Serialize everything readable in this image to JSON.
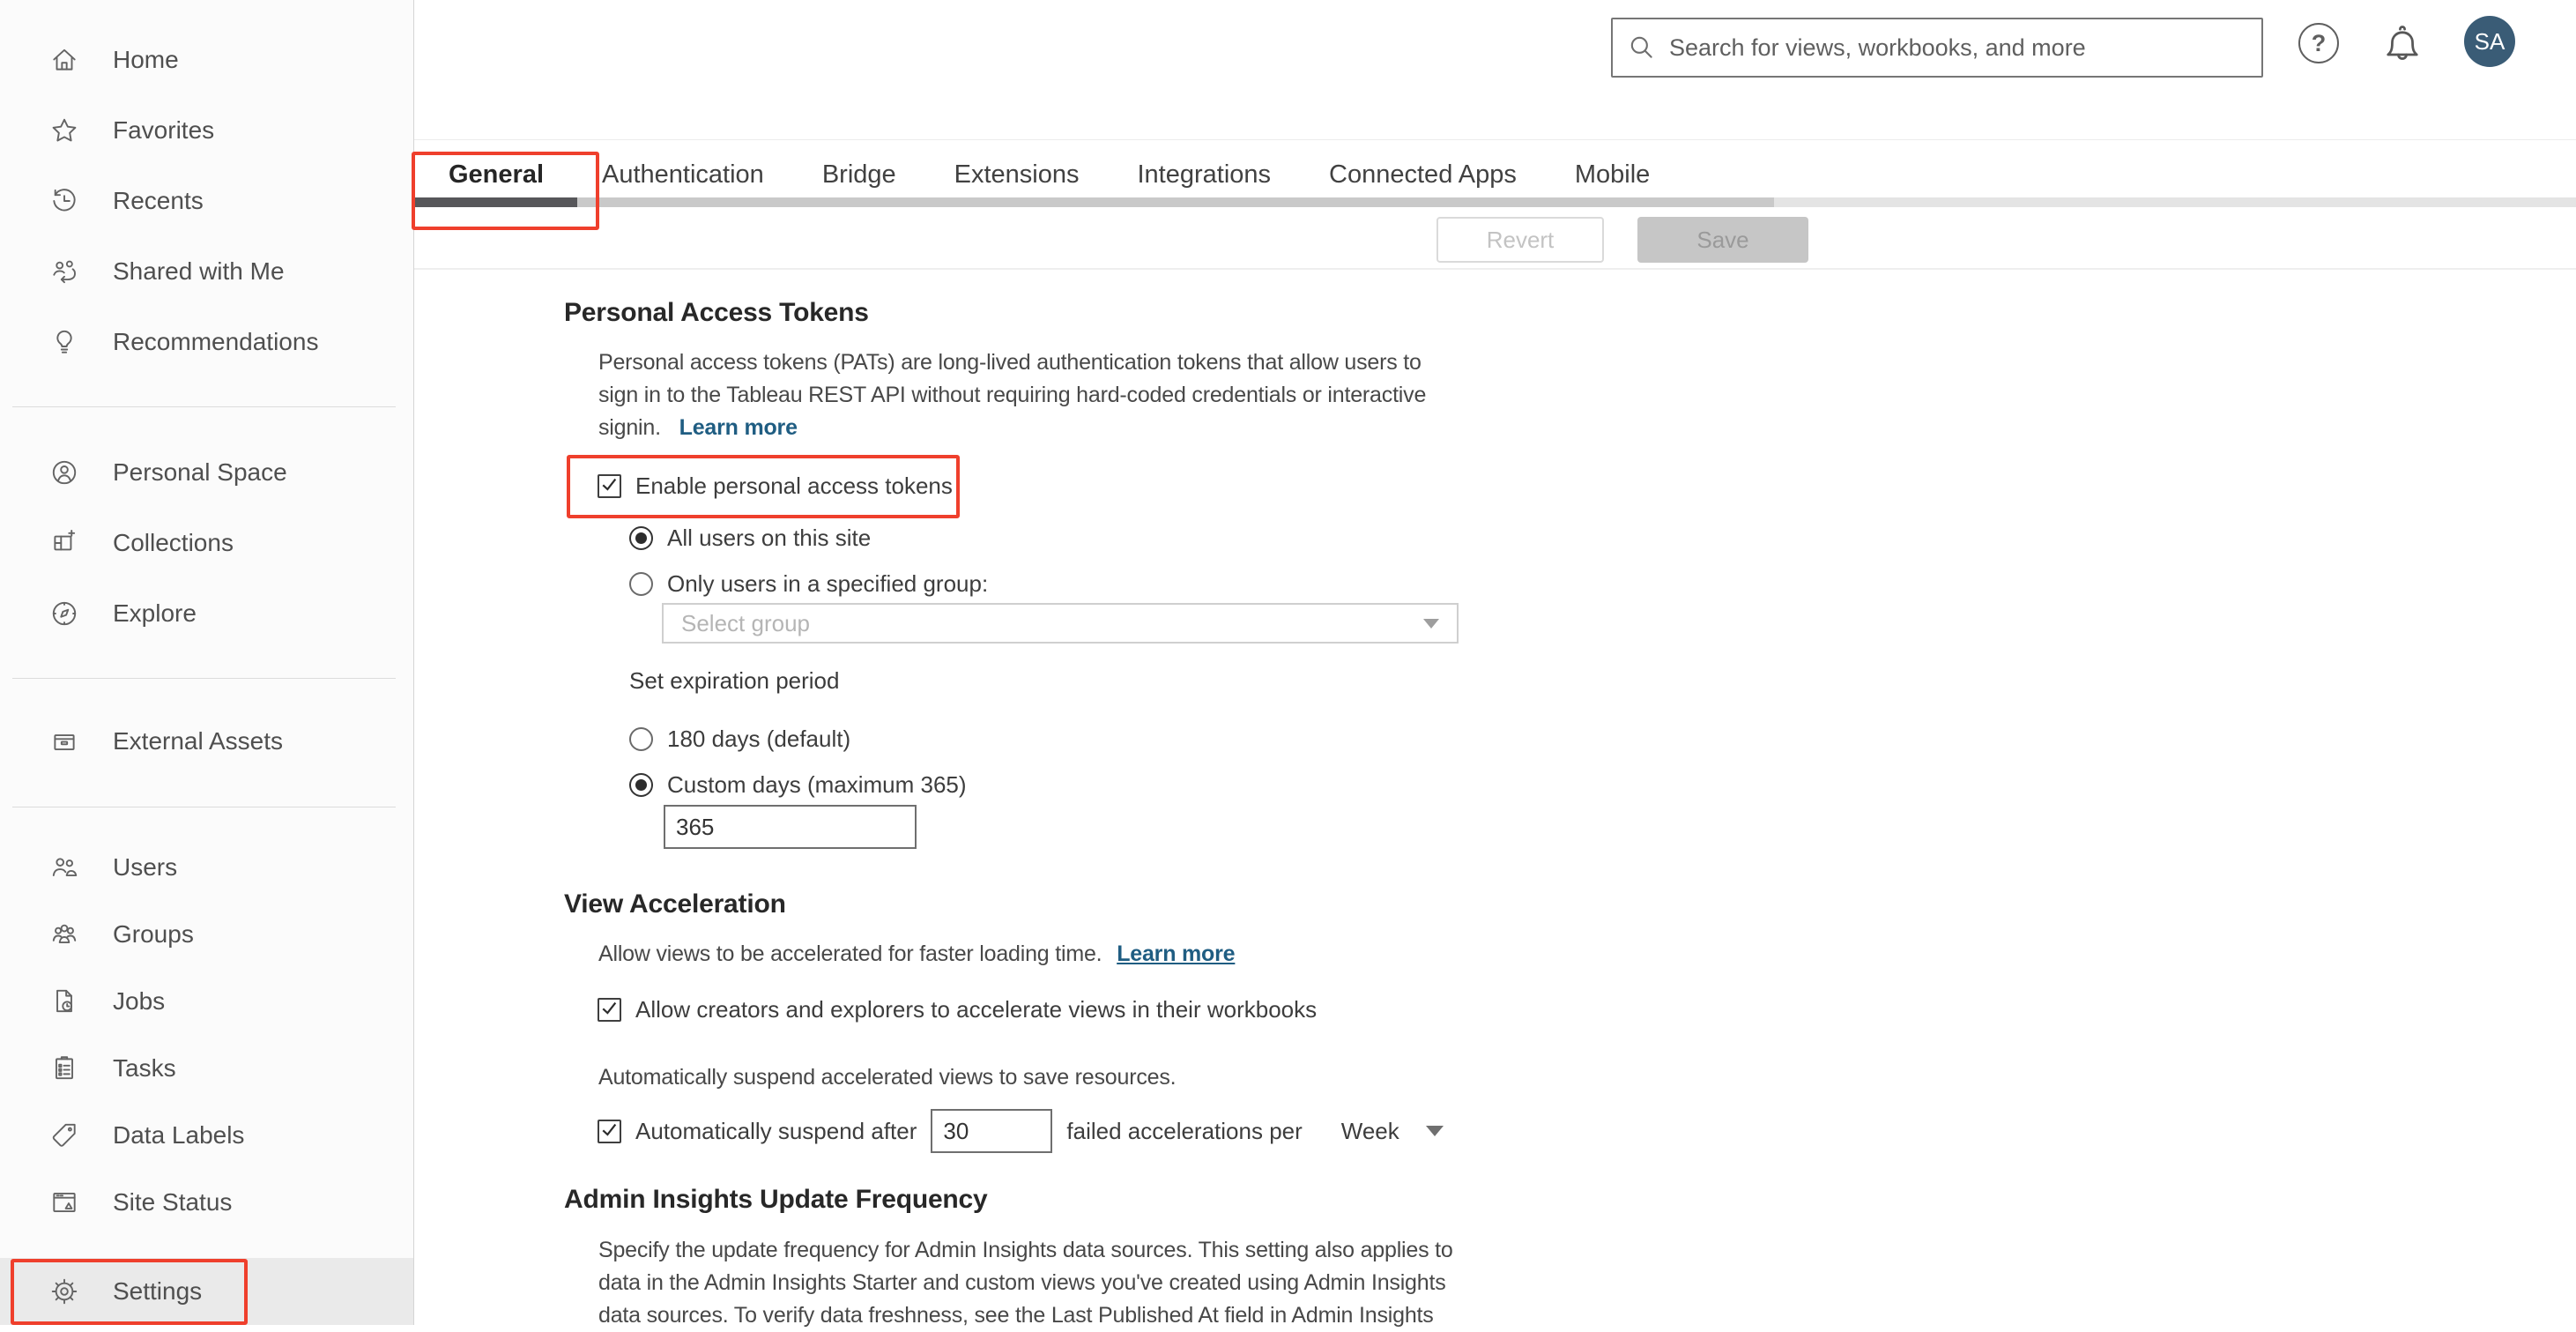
{
  "header": {
    "search_placeholder": "Search for views, workbooks, and more",
    "avatar_initials": "SA",
    "help_glyph": "?"
  },
  "sidebar": {
    "items": [
      {
        "label": "Home",
        "icon": "home"
      },
      {
        "label": "Favorites",
        "icon": "star"
      },
      {
        "label": "Recents",
        "icon": "recents"
      },
      {
        "label": "Shared with Me",
        "icon": "shared"
      },
      {
        "label": "Recommendations",
        "icon": "lightbulb"
      },
      {
        "divider": true
      },
      {
        "label": "Personal Space",
        "icon": "person-circle"
      },
      {
        "label": "Collections",
        "icon": "collections"
      },
      {
        "label": "Explore",
        "icon": "compass"
      },
      {
        "divider": true
      },
      {
        "label": "External Assets",
        "icon": "external-assets"
      },
      {
        "divider": true
      },
      {
        "label": "Users",
        "icon": "users"
      },
      {
        "label": "Groups",
        "icon": "groups"
      },
      {
        "label": "Jobs",
        "icon": "jobs"
      },
      {
        "label": "Tasks",
        "icon": "tasks"
      },
      {
        "label": "Data Labels",
        "icon": "tag"
      },
      {
        "label": "Site Status",
        "icon": "site-status"
      },
      {
        "label": "Settings",
        "icon": "gear",
        "selected": true
      }
    ]
  },
  "tabs": {
    "items": [
      "General",
      "Authentication",
      "Bridge",
      "Extensions",
      "Integrations",
      "Connected Apps",
      "Mobile"
    ],
    "active": "General"
  },
  "toolbar": {
    "revert_label": "Revert",
    "save_label": "Save"
  },
  "sections": {
    "pat": {
      "title": "Personal Access Tokens",
      "description_lines": [
        "Personal access tokens (PATs) are long-lived authentication tokens that allow users to",
        "sign in to the Tableau REST API without requiring hard-coded credentials or interactive",
        "signin."
      ],
      "learn_more_label": "Learn more",
      "enable_label": "Enable personal access tokens",
      "enable_checked": true,
      "radio_all_users_label": "All users on this site",
      "all_users_selected": true,
      "radio_group_label": "Only users in a specified group:",
      "group_selected": false,
      "group_placeholder": "Select group",
      "expiration_label": "Set expiration period",
      "radio_180_label": "180 days (default)",
      "days180_selected": false,
      "radio_custom_label": "Custom days (maximum 365)",
      "custom_selected": true,
      "custom_days_value": "365"
    },
    "va": {
      "title": "View Acceleration",
      "description": "Allow views to be accelerated for faster loading time.",
      "learn_more_label": "Learn more",
      "allow_label": "Allow creators and explorers to accelerate views in their workbooks",
      "allow_checked": true,
      "suspend_description": "Automatically suspend accelerated views to save resources.",
      "suspend_before_label": "Automatically suspend after",
      "suspend_value": "30",
      "suspend_after_label": "failed accelerations per",
      "suspend_checked": true,
      "period_value": "Week"
    },
    "admin": {
      "title": "Admin Insights Update Frequency",
      "description_lines": [
        "Specify the update frequency for Admin Insights data sources. This setting also applies to",
        "data in the Admin Insights Starter and custom views you've created using Admin Insights",
        "data sources. To verify data freshness, see the Last Published At field in Admin Insights"
      ]
    }
  },
  "colors": {
    "annotation_red": "#ef3f2c",
    "link_blue": "#1f5d82",
    "avatar_bg": "#3a5c76",
    "active_tab_underline": "#57575a"
  }
}
